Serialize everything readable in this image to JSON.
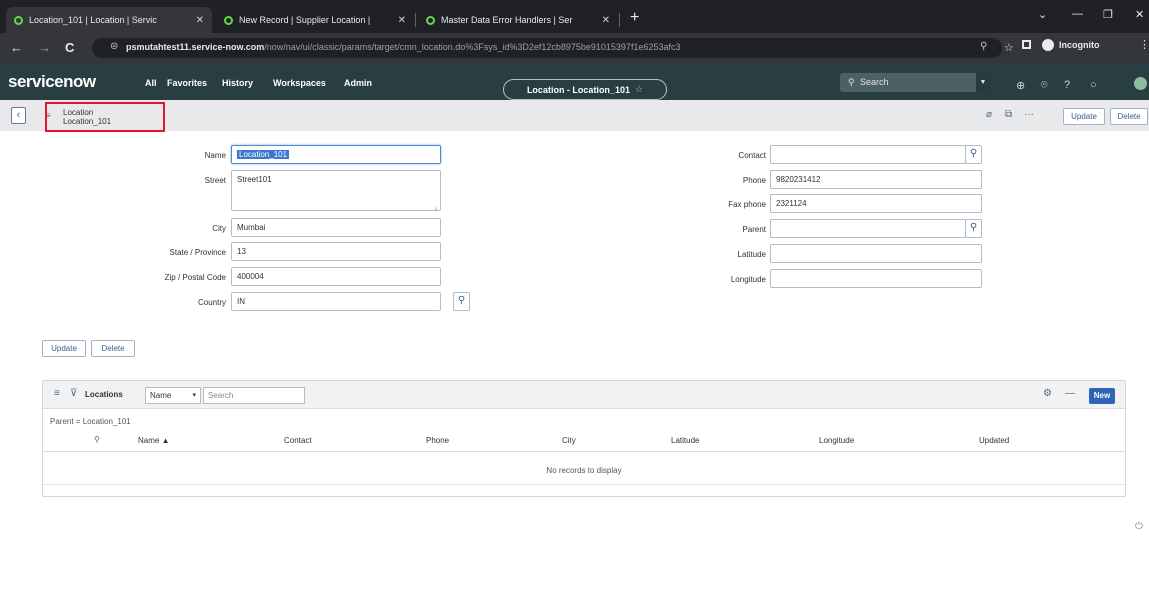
{
  "browser": {
    "tabs": [
      {
        "label": "Location_101 | Location | Servic"
      },
      {
        "label": "New Record | Supplier Location |"
      },
      {
        "label": "Master Data Error Handlers | Ser"
      }
    ],
    "url_host": "psmutahtest11.service-now.com",
    "url_path": "/now/nav/ui/classic/params/target/cmn_location.do%3Fsys_id%3D2ef12cb8975be91015397f1e6253afc3",
    "incognito_label": "Incognito"
  },
  "header": {
    "logo": "servicenow",
    "nav": [
      "All",
      "Favorites",
      "History",
      "Workspaces",
      "Admin"
    ],
    "context_title": "Location - Location_101",
    "search_placeholder": "Search"
  },
  "form_header": {
    "breadcrumb_table": "Location",
    "breadcrumb_record": "Location_101",
    "update_label": "Update",
    "delete_label": "Delete"
  },
  "form": {
    "left": {
      "name": {
        "label": "Name",
        "value": "Location_101"
      },
      "street": {
        "label": "Street",
        "value": "Street101"
      },
      "city": {
        "label": "City",
        "value": "Mumbai"
      },
      "state": {
        "label": "State / Province",
        "value": "13"
      },
      "zip": {
        "label": "Zip / Postal Code",
        "value": "400004"
      },
      "country": {
        "label": "Country",
        "value": "IN"
      }
    },
    "right": {
      "contact": {
        "label": "Contact",
        "value": ""
      },
      "phone": {
        "label": "Phone",
        "value": "9820231412"
      },
      "fax": {
        "label": "Fax phone",
        "value": "2321124"
      },
      "parent": {
        "label": "Parent",
        "value": ""
      },
      "latitude": {
        "label": "Latitude",
        "value": ""
      },
      "longitude": {
        "label": "Longitude",
        "value": ""
      }
    },
    "update_label": "Update",
    "delete_label": "Delete"
  },
  "related_list": {
    "title": "Locations",
    "search_field": "Name",
    "search_placeholder": "Search",
    "new_label": "New",
    "filter": "Parent = Location_101",
    "columns": [
      "Name ▲",
      "Contact",
      "Phone",
      "City",
      "Latitude",
      "Longitude",
      "Updated"
    ],
    "empty_message": "No records to display"
  }
}
